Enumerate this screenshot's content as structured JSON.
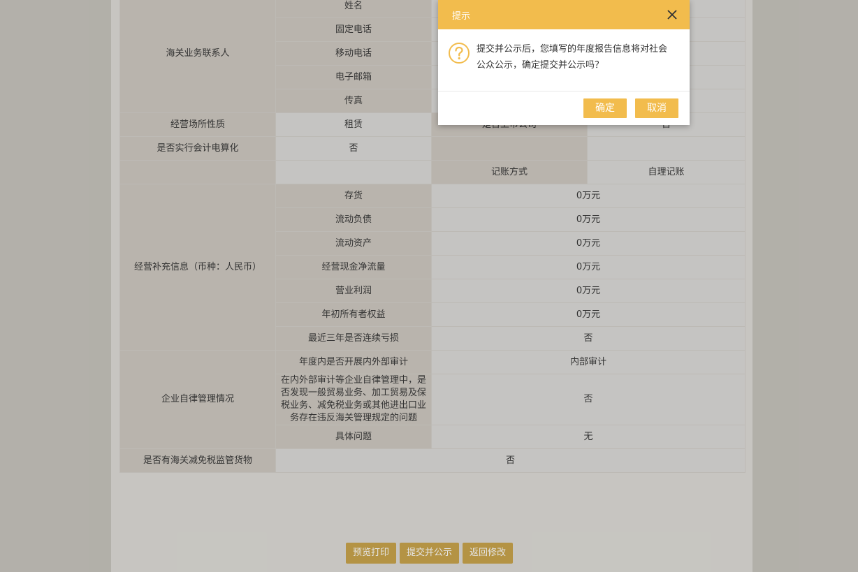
{
  "report": {
    "contact_section": "海关业务联系人",
    "contact_fields": [
      "姓名",
      "固定电话",
      "移动电话",
      "电子邮箱",
      "传真"
    ],
    "premises": {
      "label": "经营场所性质",
      "value": "租赁",
      "label2": "是否上市公司",
      "value2": "否"
    },
    "accounting": {
      "label": "是否实行会计电算化",
      "value": "否"
    },
    "bookkeeping": {
      "label": "记账方式",
      "value": "自理记账"
    },
    "supplement": {
      "section": "经营补充信息（币种：人民币）",
      "rows": [
        {
          "label": "存货",
          "value": "0万元"
        },
        {
          "label": "流动负债",
          "value": "0万元"
        },
        {
          "label": "流动资产",
          "value": "0万元"
        },
        {
          "label": "经营现金净流量",
          "value": "0万元"
        },
        {
          "label": "营业利润",
          "value": "0万元"
        },
        {
          "label": "年初所有者权益",
          "value": "0万元"
        },
        {
          "label": "最近三年是否连续亏损",
          "value": "否"
        }
      ]
    },
    "selfdiscipline": {
      "section": "企业自律管理情况",
      "rows": [
        {
          "label": "年度内是否开展内外部审计",
          "value": "内部审计"
        },
        {
          "label": "在内外部审计等企业自律管理中，是否发现一般贸易业务、加工贸易及保税业务、减免税业务或其他进出口业务存在违反海关管理规定的问题",
          "value": "否"
        },
        {
          "label": "具体问题",
          "value": "无"
        }
      ]
    },
    "dutyfree": {
      "label": "是否有海关减免税监管货物",
      "value": "否"
    }
  },
  "actions": {
    "preview": "预览打印",
    "submit": "提交并公示",
    "back": "返回修改"
  },
  "dialog": {
    "title": "提示",
    "message": "提交并公示后，您填写的年度报告信息将对社会公众公示，确定提交并公示吗？",
    "confirm": "确定",
    "cancel": "取消"
  },
  "colors": {
    "accent": "#f2bc4d",
    "action_button": "#c9a44c"
  }
}
